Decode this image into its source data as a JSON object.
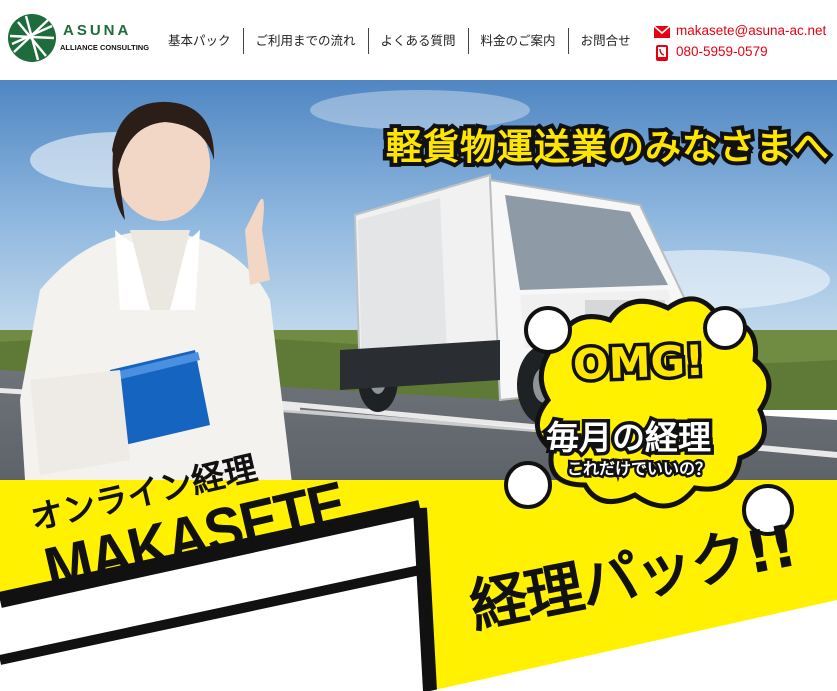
{
  "header": {
    "logo": {
      "name": "ASUNA",
      "subtitle": "ALLIANCE CONSULTING"
    },
    "nav": [
      {
        "label": "基本パック"
      },
      {
        "label": "ご利用までの流れ"
      },
      {
        "label": "よくある質問"
      },
      {
        "label": "料金のご案内"
      },
      {
        "label": "お問合せ"
      }
    ],
    "contact": {
      "email": "makasete@asuna-ac.net",
      "email_icon": "mail-icon",
      "phone": "080-5959-0579",
      "phone_icon": "phone-icon"
    }
  },
  "hero": {
    "headline": "軽貨物運送業のみなさまへ",
    "bubble": {
      "exclaim": "OMG!",
      "main": "毎月の経理",
      "sub": "これだけでいいの？"
    },
    "service_prefix": "オンライン経理",
    "service_name": "MAKASETE",
    "product": "経理パック!!"
  },
  "colors": {
    "brand_green": "#1e6b3c",
    "accent_red": "#e60012",
    "hero_yellow": "#fff100",
    "ink": "#111111"
  }
}
